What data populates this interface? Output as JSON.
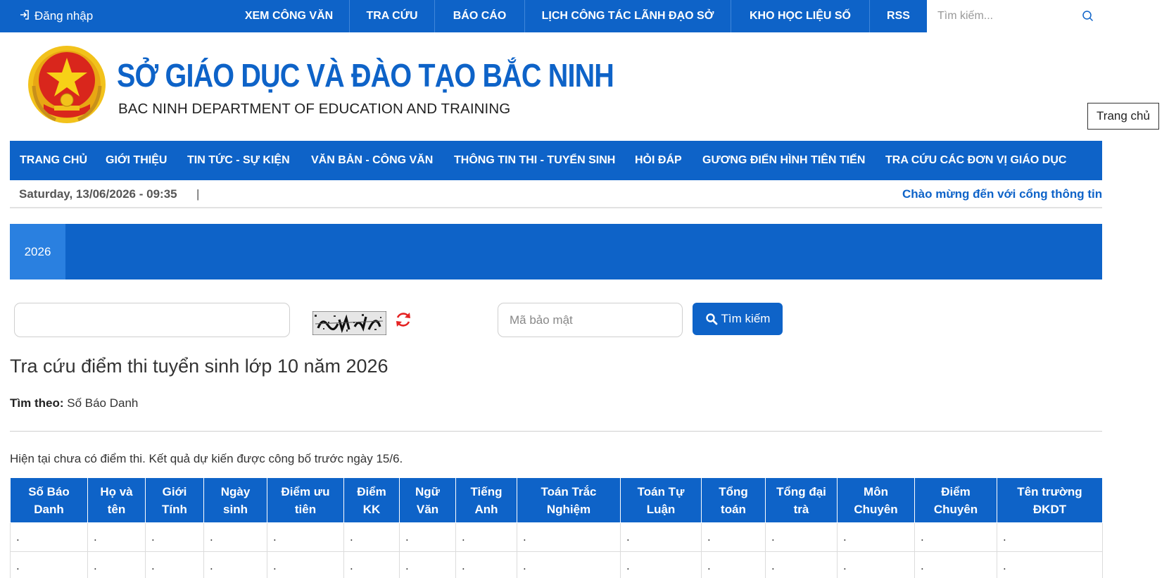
{
  "topbar": {
    "login_icon": "sign-in-icon",
    "login_label": "Đăng nhập",
    "menu": [
      {
        "label": "XEM CÔNG VĂN"
      },
      {
        "label": "TRA CỨU"
      },
      {
        "label": "BÁO CÁO"
      },
      {
        "label": "LỊCH CÔNG TÁC LÃNH ĐẠO SỞ"
      },
      {
        "label": "KHO HỌC LIỆU SỐ"
      },
      {
        "label": "RSS"
      }
    ],
    "search_placeholder": "Tìm kiếm...",
    "search_icon": "search-icon"
  },
  "header": {
    "emblem_icon": "national-emblem-icon",
    "title": "SỞ GIÁO DỤC VÀ ĐÀO TẠO BẮC NINH",
    "subtitle": "BAC NINH DEPARTMENT OF EDUCATION AND TRAINING",
    "home_button": "Trang chủ"
  },
  "mainnav": {
    "items": [
      {
        "label": "TRANG CHỦ"
      },
      {
        "label": "GIỚI THIỆU"
      },
      {
        "label": "TIN TỨC - SỰ KIỆN"
      },
      {
        "label": "VĂN BẢN - CÔNG VĂN"
      },
      {
        "label": "THÔNG TIN THI - TUYỂN SINH"
      },
      {
        "label": "HỎI ĐÁP"
      },
      {
        "label": "GƯƠNG ĐIỂN HÌNH TIÊN TIẾN"
      },
      {
        "label": "TRA CỨU CÁC ĐƠN VỊ GIÁO DỤC"
      }
    ]
  },
  "datebar": {
    "datetime": "Saturday, 13/06/2026 - 09:35",
    "separator": "|",
    "marquee": "Chào mừng đến với cổng thông tin"
  },
  "year_tabs": [
    {
      "label": "2026",
      "active": true
    }
  ],
  "search_form": {
    "candidate_number_value": "",
    "captcha_icon": "captcha-image",
    "refresh_icon": "refresh-icon",
    "security_code_placeholder": "Mã bảo mật",
    "search_button": "Tìm kiếm"
  },
  "content": {
    "title": "Tra cứu điểm thi tuyển sinh lớp 10 năm 2026",
    "search_by_label": "Tìm theo:",
    "search_by_value": "Số Báo Danh",
    "notice": "Hiện tại chưa có điểm thi. Kết quả dự kiến được công bố trước ngày 15/6."
  },
  "table": {
    "headers": [
      [
        "Số Báo",
        "Danh"
      ],
      [
        "Họ và",
        "tên"
      ],
      [
        "Giới",
        "Tính"
      ],
      [
        "Ngày",
        "sinh"
      ],
      [
        "Điểm ưu",
        "tiên"
      ],
      [
        "Điểm",
        "KK"
      ],
      [
        "Ngữ",
        "Văn"
      ],
      [
        "Tiếng",
        "Anh"
      ],
      [
        "Toán Trắc",
        "Nghiệm"
      ],
      [
        "Toán Tự",
        "Luận"
      ],
      [
        "Tổng",
        "toán"
      ],
      [
        "Tổng đại",
        "trà"
      ],
      [
        "Môn",
        "Chuyên"
      ],
      [
        "Điểm",
        "Chuyên"
      ],
      [
        "Tên trường",
        "ĐKDT"
      ]
    ],
    "rows": [
      [
        ".",
        ".",
        ".",
        ".",
        ".",
        ".",
        ".",
        ".",
        ".",
        ".",
        ".",
        ".",
        ".",
        ".",
        "."
      ],
      [
        ".",
        ".",
        ".",
        ".",
        ".",
        ".",
        ".",
        ".",
        ".",
        ".",
        ".",
        ".",
        ".",
        ".",
        "."
      ]
    ]
  },
  "colors": {
    "primary": "#0e63c8",
    "active_tab": "#2a80e0",
    "emblem_red": "#d9261c",
    "emblem_gold": "#f2c21b"
  }
}
